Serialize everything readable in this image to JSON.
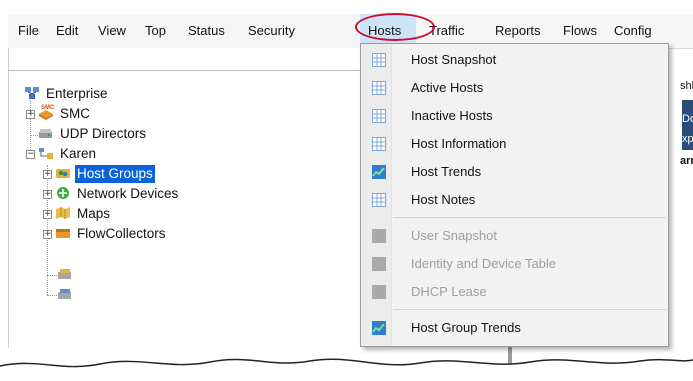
{
  "menubar": {
    "items": [
      {
        "label": "File"
      },
      {
        "label": "Edit"
      },
      {
        "label": "View"
      },
      {
        "label": "Top"
      },
      {
        "label": "Status"
      },
      {
        "label": "Security"
      },
      {
        "label": "Hosts"
      },
      {
        "label": "Traffic"
      },
      {
        "label": "Reports"
      },
      {
        "label": "Flows"
      },
      {
        "label": "Config"
      }
    ],
    "highlight_color": "#c8102e"
  },
  "tree": {
    "root": {
      "label": "Enterprise",
      "icon": "enterprise-icon"
    },
    "smc": {
      "label": "SMC",
      "badge": "SMC",
      "icon": "smc-icon"
    },
    "udp": {
      "label": "UDP Directors",
      "icon": "udp-director-icon"
    },
    "karen": {
      "label": "Karen",
      "icon": "domain-icon"
    },
    "children": [
      {
        "label": "Host Groups",
        "icon": "host-groups-icon",
        "selected": true
      },
      {
        "label": "Network Devices",
        "icon": "network-devices-icon"
      },
      {
        "label": "Maps",
        "icon": "maps-icon"
      },
      {
        "label": "FlowCollectors",
        "icon": "flowcollectors-icon"
      }
    ],
    "selection_color": "#0a64d8"
  },
  "hosts_menu": {
    "items": [
      {
        "label": "Host Snapshot",
        "icon": "table-icon",
        "enabled": true
      },
      {
        "label": "Active Hosts",
        "icon": "table-icon",
        "enabled": true
      },
      {
        "label": "Inactive Hosts",
        "icon": "table-icon",
        "enabled": true
      },
      {
        "label": "Host Information",
        "icon": "table-icon",
        "enabled": true
      },
      {
        "label": "Host Trends",
        "icon": "trend-chart-icon",
        "enabled": true
      },
      {
        "label": "Host Notes",
        "icon": "table-icon",
        "enabled": true
      },
      {
        "label": "User Snapshot",
        "icon": "table-icon",
        "enabled": false
      },
      {
        "label": "Identity and Device Table",
        "icon": "table-icon",
        "enabled": false
      },
      {
        "label": "DHCP Lease",
        "icon": "table-icon",
        "enabled": false
      },
      {
        "label": "Host Group Trends",
        "icon": "trend-chart-icon",
        "enabled": true
      }
    ]
  },
  "right_strip": {
    "fragments": [
      "shb",
      "Dom",
      "xpo",
      "arm"
    ]
  }
}
